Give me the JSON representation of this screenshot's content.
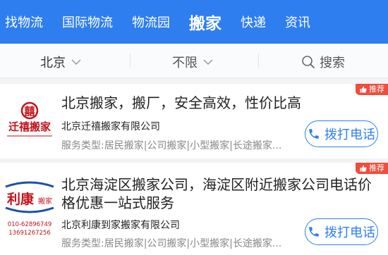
{
  "nav": {
    "items": [
      {
        "label": "找物流",
        "active": false
      },
      {
        "label": "国际物流",
        "active": false
      },
      {
        "label": "物流园",
        "active": false
      },
      {
        "label": "搬家",
        "active": true
      },
      {
        "label": "快递",
        "active": false
      },
      {
        "label": "资讯",
        "active": false
      }
    ]
  },
  "filters": {
    "city": "北京",
    "range": "不限",
    "search": "搜索"
  },
  "colors": {
    "brand": "#2f7ef0",
    "badge": "#ef4d3d"
  },
  "listings": [
    {
      "badge": "推荐",
      "title": "北京搬家，搬厂，安全高效，性价比高",
      "company": "北京迁禧搬家有限公司",
      "service": "服务类型:居民搬家|公司搬家|小型搬家|长途搬家...",
      "call_label": "拨打电话",
      "logo": {
        "text": "迁禧搬家",
        "emblem": "囍"
      }
    },
    {
      "badge": "推荐",
      "title": "北京海淀区搬家公司，海淀区附近搬家公司电话价格优惠一站式服务",
      "company": "北京利康到家搬家有限公司",
      "service": "服务类型:居民搬家|公司搬家|小型搬家|长途搬家...",
      "call_label": "拨打电话",
      "logo": {
        "text": "利康",
        "subtext": "搬家",
        "phone1": "010-62896749",
        "phone2": "13691267256"
      }
    }
  ]
}
